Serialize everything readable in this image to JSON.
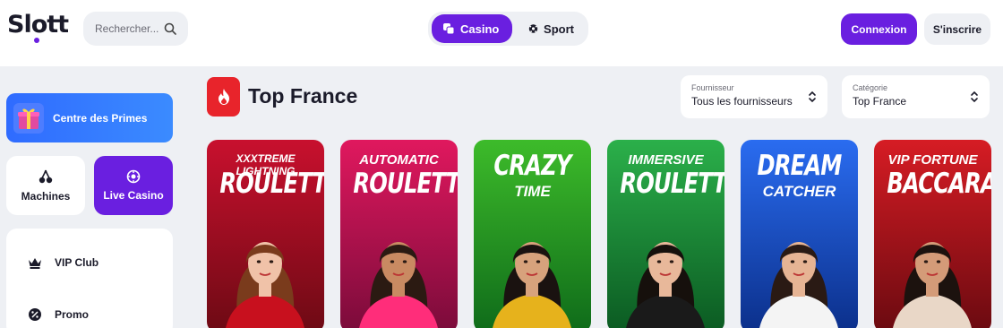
{
  "header": {
    "logo": "Slott",
    "search_placeholder": "Rechercher...",
    "tabs": [
      {
        "label": "Casino",
        "active": true
      },
      {
        "label": "Sport",
        "active": false
      }
    ],
    "login_label": "Connexion",
    "register_label": "S'inscrire"
  },
  "sidebar": {
    "primes_label": "Centre des Primes",
    "tiles": [
      {
        "label": "Machines",
        "icon": "cherries-icon"
      },
      {
        "label": "Live Casino",
        "icon": "roulette-chip-icon"
      }
    ],
    "menu": [
      {
        "label": "VIP Club",
        "icon": "crown-icon"
      },
      {
        "label": "Promo",
        "icon": "promo-icon"
      }
    ]
  },
  "section": {
    "title": "Top France",
    "icon": "fire-icon"
  },
  "filters": {
    "provider": {
      "label": "Fournisseur",
      "value": "Tous les fournisseurs"
    },
    "category": {
      "label": "Catégorie",
      "value": "Top France"
    }
  },
  "games": [
    {
      "top": "XXXTREME LIGHTNING",
      "main": "ROULETTE",
      "sub": "",
      "color_from": "#c8102e",
      "color_to": "#6d0a14"
    },
    {
      "top": "AUTOMATIC",
      "main": "ROULETTE",
      "sub": "",
      "color_from": "#e0185e",
      "color_to": "#7a0b3a"
    },
    {
      "top": "",
      "main": "CRAZY",
      "sub": "TIME",
      "color_from": "#3dbb2a",
      "color_to": "#0f6b1a"
    },
    {
      "top": "IMMERSIVE",
      "main": "ROULETTE",
      "sub": "",
      "color_from": "#2bb04a",
      "color_to": "#0b5a22"
    },
    {
      "top": "",
      "main": "DREAM",
      "sub": "CATCHER",
      "color_from": "#2a6cf0",
      "color_to": "#0b2f8a"
    },
    {
      "top": "VIP FORTUNE",
      "main": "BACCARAT",
      "sub": "",
      "color_from": "#d61c24",
      "color_to": "#6a0a10"
    }
  ],
  "colors": {
    "accent": "#6a1fe0",
    "primes_blue": "#2f6bff",
    "fire_red": "#e8242b",
    "background": "#eef0f4"
  }
}
